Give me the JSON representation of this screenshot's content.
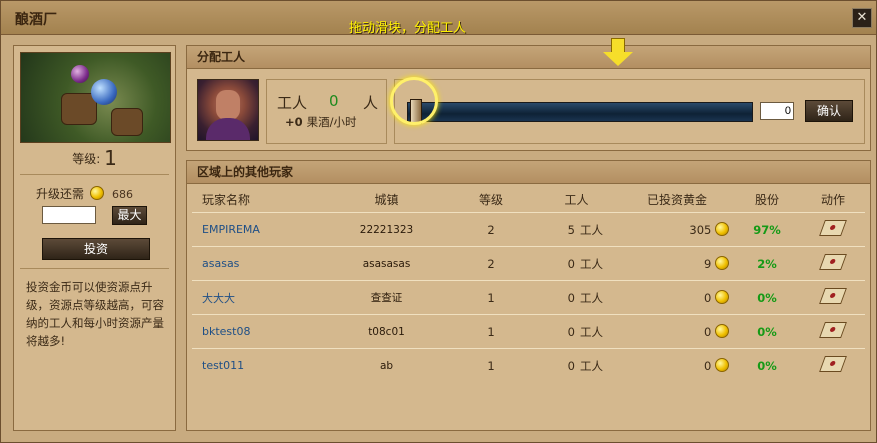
{
  "window": {
    "title": "酿酒厂",
    "hint": "拖动滑块，分配工人",
    "close_glyph": "✕"
  },
  "left": {
    "level_label": "等级:",
    "level_value": "1",
    "upgrade_label": "升级还需",
    "upgrade_cost": "686",
    "amount_value": "",
    "max_label": "最大",
    "invest_label": "投资",
    "description": "投资金币可以使资源点升级，资源点等级越高，可容纳的工人和每小时资源产量将越多!"
  },
  "assign": {
    "header": "分配工人",
    "worker_label": "工人",
    "worker_count": "0",
    "worker_unit": "人",
    "rate_value": "+0",
    "rate_unit": "果酒/小时",
    "slider_value": 0,
    "qty_value": "0",
    "confirm_label": "确认"
  },
  "players": {
    "header": "区域上的其他玩家",
    "columns": [
      "玩家名称",
      "城镇",
      "等级",
      "工人",
      "已投资黄金",
      "股份",
      "动作"
    ],
    "rows": [
      {
        "name": "EMPIREMA",
        "town": "22221323",
        "level": "2",
        "workers": "5",
        "worker_unit": "工人",
        "gold": "305",
        "share": "97%"
      },
      {
        "name": "asasas",
        "town": "asasasas",
        "level": "2",
        "workers": "0",
        "worker_unit": "工人",
        "gold": "9",
        "share": "2%"
      },
      {
        "name": "大大大",
        "town": "查查证",
        "level": "1",
        "workers": "0",
        "worker_unit": "工人",
        "gold": "0",
        "share": "0%"
      },
      {
        "name": "bktest08",
        "town": "t08c01",
        "level": "1",
        "workers": "0",
        "worker_unit": "工人",
        "gold": "0",
        "share": "0%"
      },
      {
        "name": "test011",
        "town": "ab",
        "level": "1",
        "workers": "0",
        "worker_unit": "工人",
        "gold": "0",
        "share": "0%"
      }
    ]
  },
  "icons": {
    "coin": "gold-coin-icon",
    "action": "scroll-action-icon",
    "arrow": "down-arrow-icon"
  },
  "colors": {
    "share_green": "#169a16",
    "link_blue": "#1f4f86",
    "hint_yellow": "#fff200"
  }
}
